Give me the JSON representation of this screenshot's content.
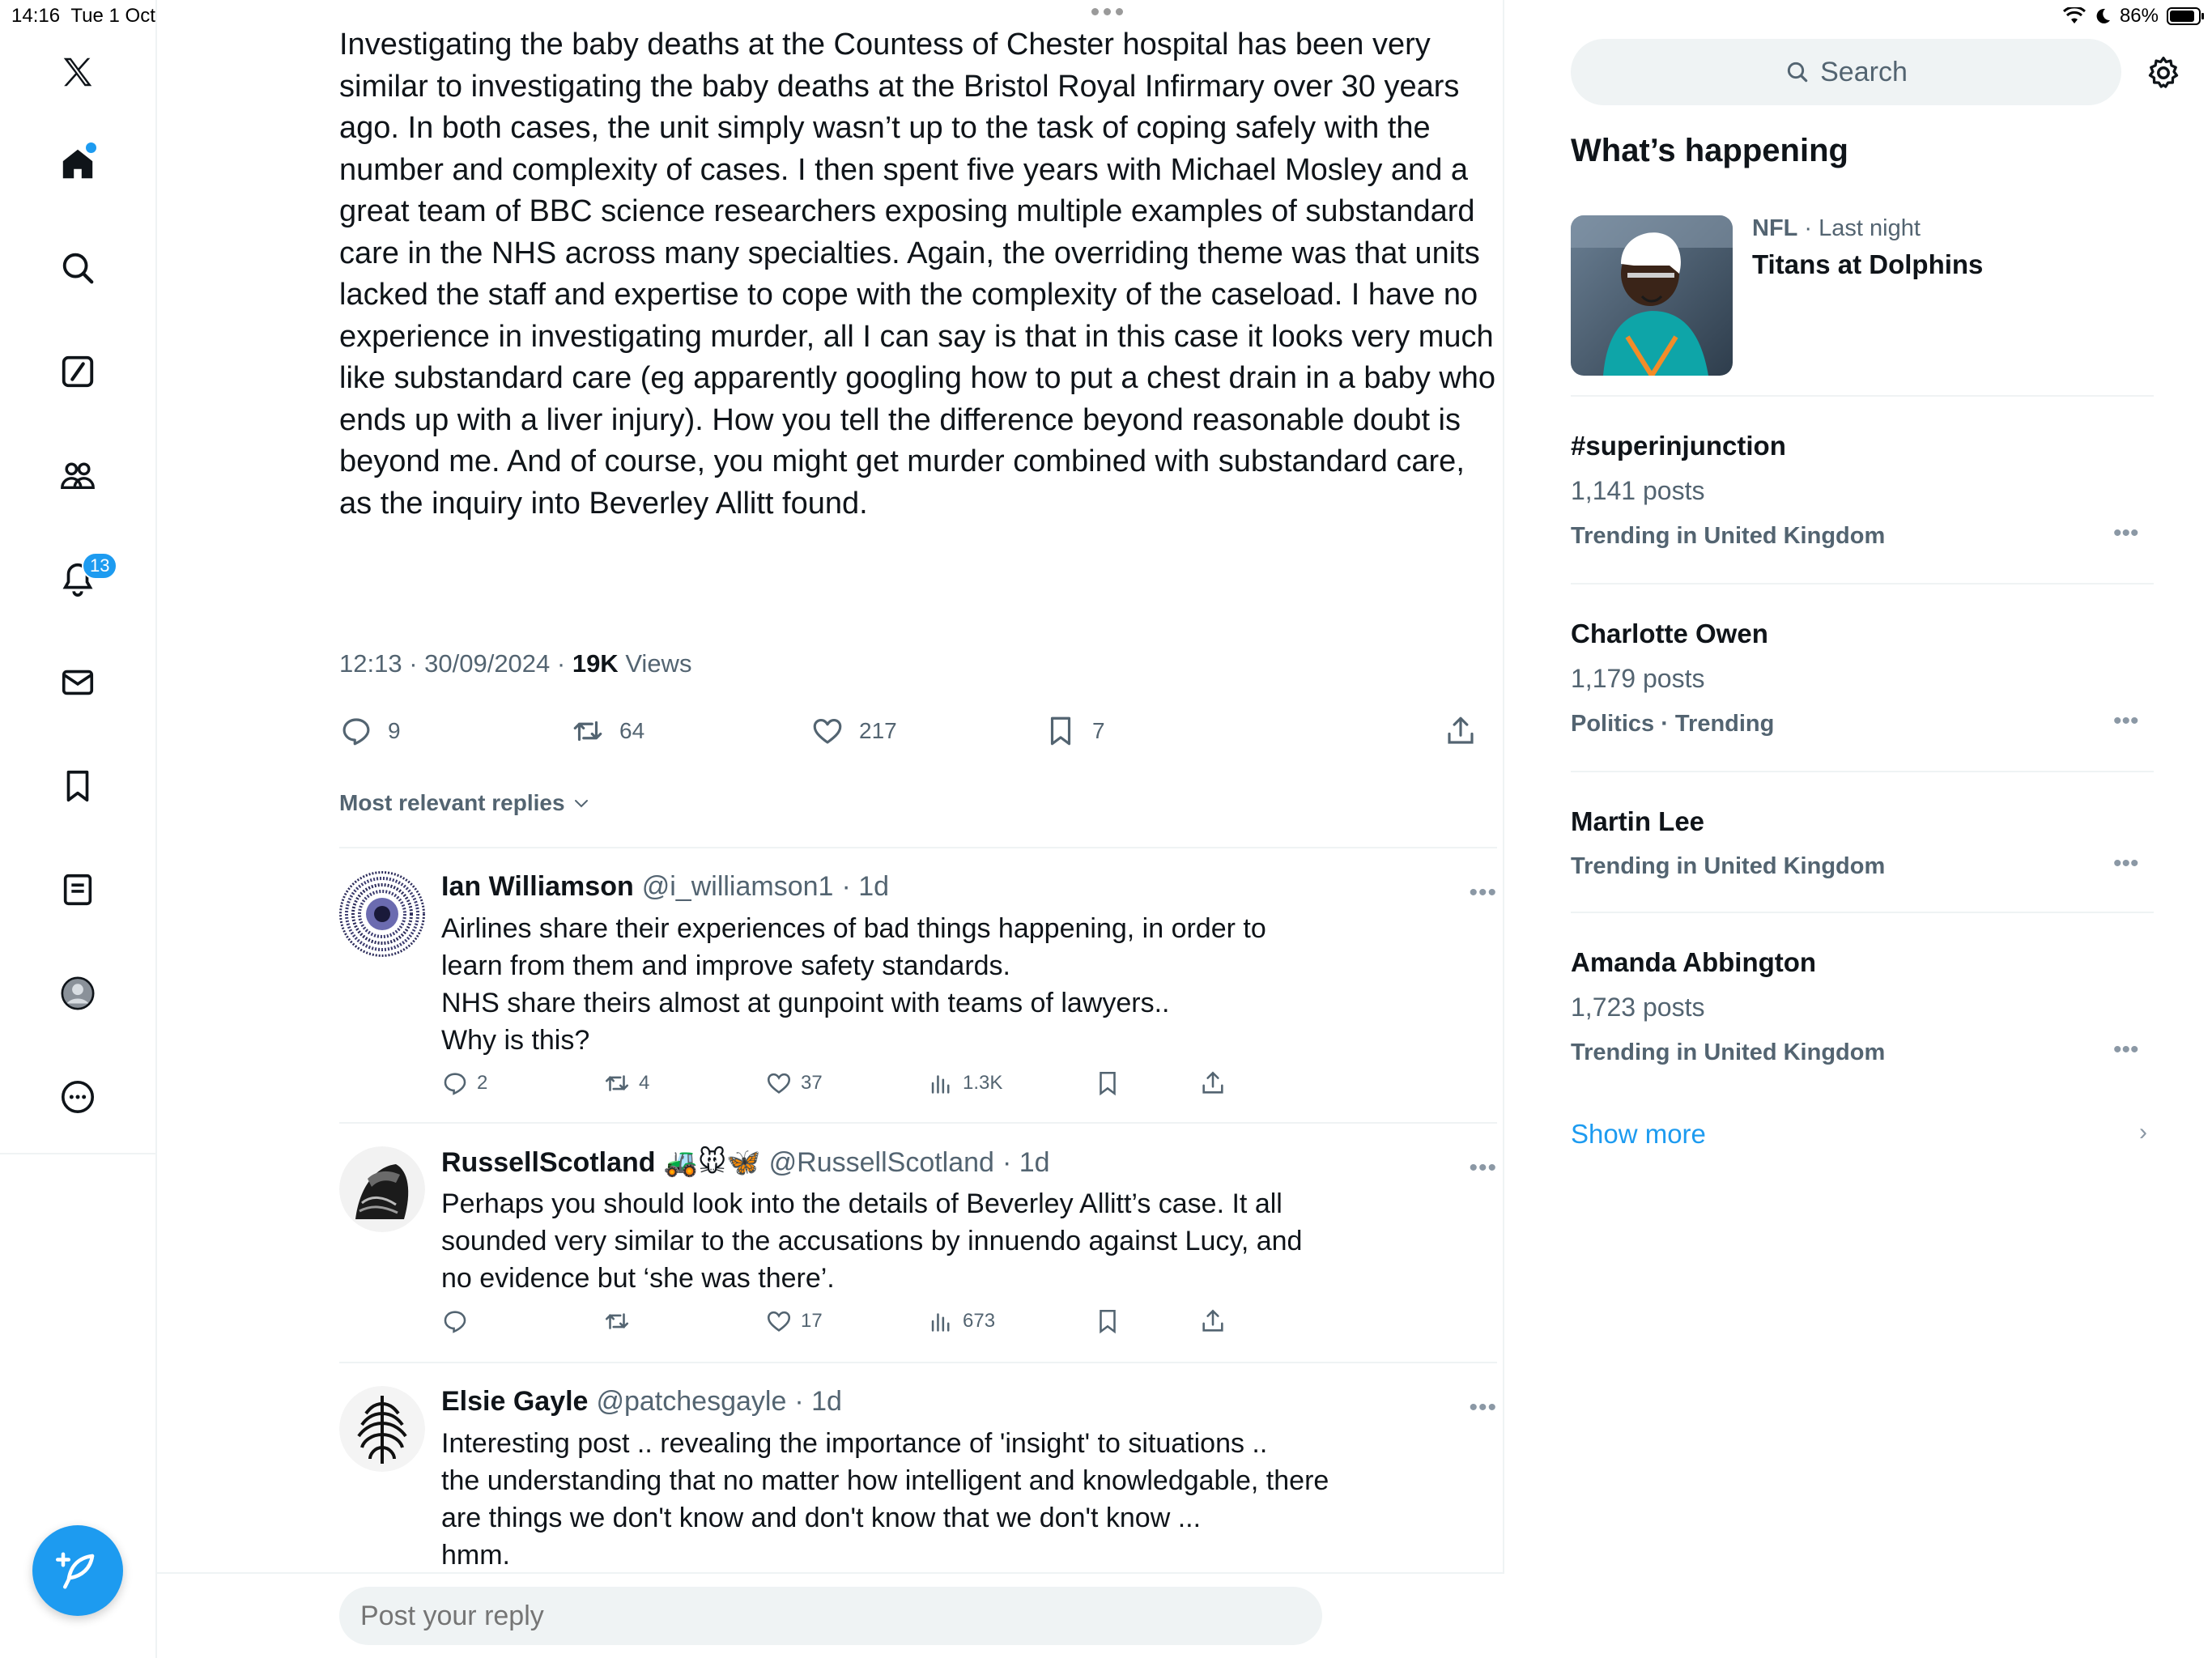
{
  "status_bar": {
    "time": "14:16",
    "date": "Tue 1 Oct",
    "battery": "86%"
  },
  "nav": {
    "notifications_badge": "13"
  },
  "tweet": {
    "text": "Investigating the baby deaths at the Countess of Chester hospital has been very similar to investigating the baby deaths at the Bristol Royal Infirmary over 30 years ago. In both cases, the unit simply wasn’t up to the task of coping safely with the number and complexity of cases. I then spent five years with Michael Mosley and a great team of BBC science researchers exposing multiple examples of substandard care in the NHS across many specialties. Again, the overriding theme was that units lacked the staff and expertise to cope with the complexity of the caseload. I have no experience in investigating murder, all I can say is that in this case it looks very much like substandard care (eg apparently googling how to put a chest drain in a baby who ends up with a liver injury). How you tell the difference beyond reasonable doubt is beyond me. And of course, you might get murder combined with substandard care, as the inquiry into Beverley Allitt found.",
    "timestamp": "12:13 · 30/09/2024 · ",
    "views_count": "19K",
    "views_label": " Views",
    "replies": "9",
    "reposts": "64",
    "likes": "217",
    "bookmarks": "7"
  },
  "sort_label": "Most relevant replies",
  "replies": [
    {
      "name": "Ian Williamson",
      "handle": "@i_williamson1",
      "time": "· 1d",
      "text": "Airlines share their experiences of bad things happening, in order to learn from them and improve safety standards.\nNHS share theirs almost at gunpoint with teams of lawyers..\nWhy is this?",
      "replies": "2",
      "reposts": "4",
      "likes": "37",
      "views": "1.3K"
    },
    {
      "name": "RussellScotland",
      "emoji": "🚜🐭🦋",
      "handle": "@RussellScotland",
      "time": "· 1d",
      "text": "Perhaps you should look into the details of Beverley Allitt’s case. It all sounded very similar to the accusations by innuendo against Lucy, and no evidence but ‘she was there’.",
      "replies": "",
      "reposts": "",
      "likes": "17",
      "views": "673"
    },
    {
      "name": "Elsie Gayle",
      "handle": "@patchesgayle",
      "time": "· 1d",
      "text": "Interesting post .. revealing the importance of 'insight' to situations ..\nthe understanding that no matter how intelligent and knowledgable, there are things we don't know and don't know that we don't know ...\nhmm."
    }
  ],
  "reply_bar": {
    "placeholder": "Post your reply"
  },
  "sidebar": {
    "search_placeholder": "Search",
    "title": "What’s happening",
    "news": {
      "source": "NFL",
      "time": " · Last night",
      "title": "Titans at Dolphins"
    },
    "trends": [
      {
        "title": "#superinjunction",
        "count": "1,141 posts",
        "context": "Trending in United Kingdom"
      },
      {
        "title": "Charlotte Owen",
        "count": "1,179 posts",
        "context": "Politics · Trending"
      },
      {
        "title": "Martin Lee",
        "count": "",
        "context": "Trending in United Kingdom"
      },
      {
        "title": "Amanda Abbington",
        "count": "1,723 posts",
        "context": "Trending in United Kingdom"
      }
    ],
    "show_more": "Show more"
  },
  "colors": {
    "accent": "#1d9bf0",
    "text": "#0f1419",
    "muted": "#536471",
    "divider": "#eff3f4"
  }
}
